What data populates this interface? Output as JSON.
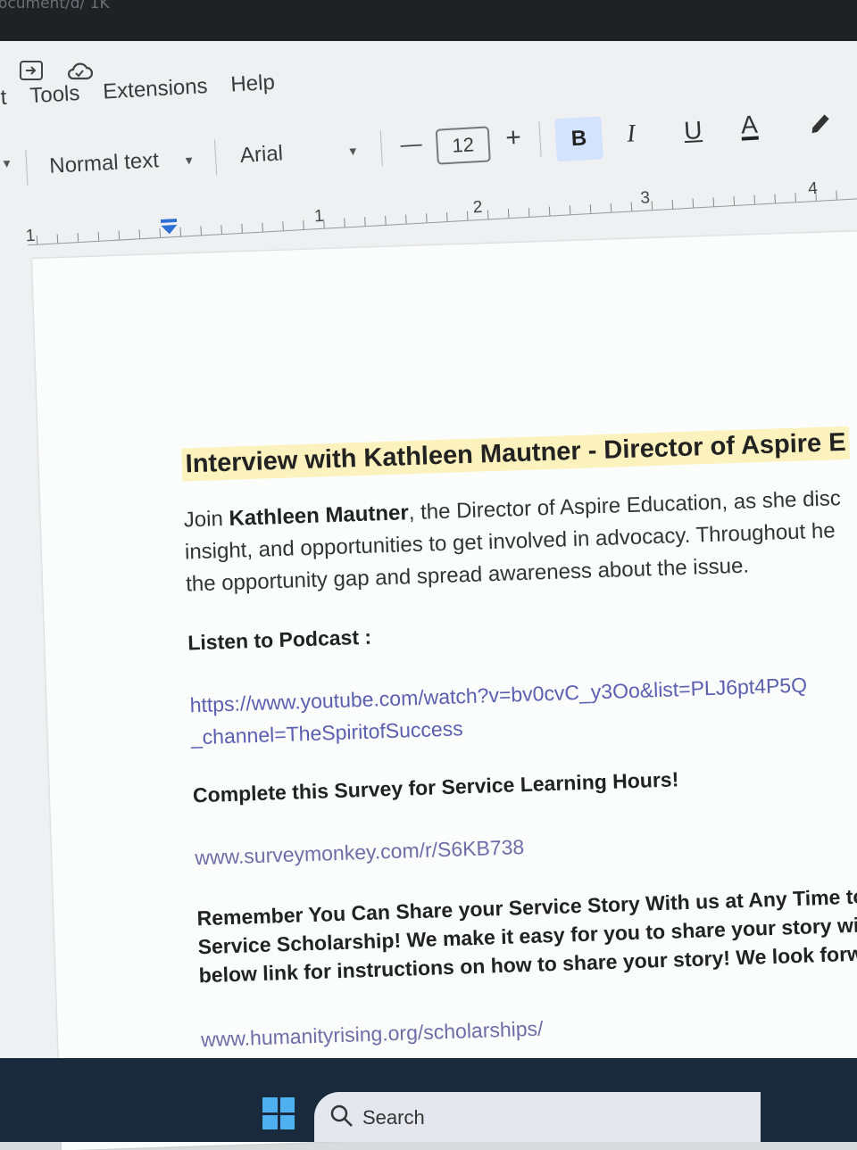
{
  "browser": {
    "url_fragment": "ocument/d/ 1K"
  },
  "menu": {
    "items": [
      "t",
      "Tools",
      "Extensions",
      "Help"
    ]
  },
  "toolbar": {
    "style": "Normal text",
    "font": "Arial",
    "decrease": "—",
    "font_size": "12",
    "increase": "+",
    "bold": "B",
    "italic": "I",
    "underline": "U",
    "text_color": "A"
  },
  "ruler": {
    "labels": [
      "1",
      "1",
      "2",
      "3",
      "4"
    ]
  },
  "document": {
    "heading": "Interview with Kathleen Mautner - Director of Aspire E",
    "intro_pre": "Join ",
    "intro_name": "Kathleen Mautner",
    "intro_post": ", the Director of Aspire Education, as she disc",
    "intro_line2": "insight, and opportunities to get involved in advocacy. Throughout he",
    "intro_line3": "the opportunity gap and spread awareness about the issue.",
    "podcast_label": "Listen to Podcast :",
    "podcast_link_line1": "https://www.youtube.com/watch?v=bv0cvC_y3Oo&list=PLJ6pt4P5Q",
    "podcast_link_line2": "_channel=TheSpiritofSuccess",
    "survey_label": "Complete this Survey for Service Learning Hours!",
    "survey_link": "www.surveymonkey.com/r/S6KB738",
    "share_line1": "Remember You Can Share your Service Story With us at Any Time to",
    "share_line2": "Service Scholarship! We make it easy for you to share your story wit",
    "share_line3": "below link for instructions on how to share your story! We look forwa",
    "scholarship_link": "www.humanityrising.org/scholarships/"
  },
  "taskbar": {
    "search_label": "Search"
  },
  "colors": {
    "highlight": "#fbf2bd",
    "link": "#5a5fb0",
    "bold_active": "#d3e3fd"
  }
}
